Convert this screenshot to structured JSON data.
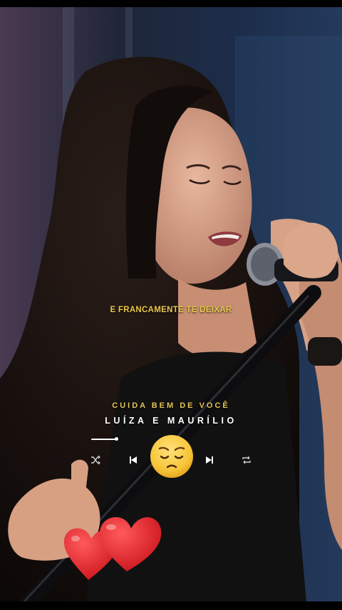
{
  "video": {
    "lyric_line": "E FRANCAMENTE TE DEIXAR"
  },
  "player": {
    "song_title": "CUIDA BEM DE VOCÊ",
    "artist": "LUÍZA E MAURÍLIO",
    "progress": 0.16,
    "controls": {
      "shuffle_icon": "shuffle-icon",
      "previous_icon": "skip-previous-icon",
      "play_icon": "pensive-face-emoji",
      "next_icon": "skip-next-icon",
      "repeat_icon": "repeat-icon"
    }
  },
  "decorations": {
    "hearts_icon": "two-red-hearts-icon"
  },
  "colors": {
    "lyric": "#e8c74a",
    "title": "#e4c458",
    "artist": "#ffffff",
    "heart": "#e0181e"
  }
}
